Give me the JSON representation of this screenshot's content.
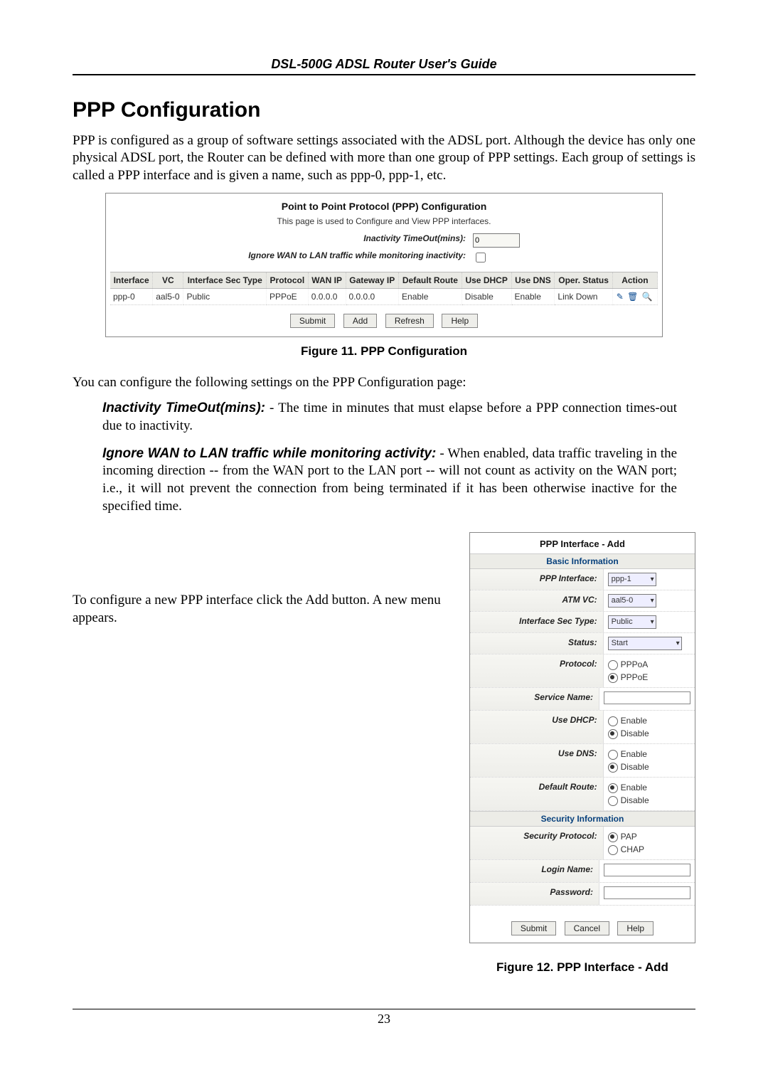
{
  "doc": {
    "running_head": "DSL-500G ADSL Router User's Guide",
    "page_number": "23"
  },
  "section": {
    "title": "PPP Configuration",
    "intro": "PPP is configured as a group of software settings associated with the ADSL port. Although the device has only one physical ADSL port, the Router can be defined with more than one group of PPP settings. Each group of settings is called a PPP interface and is given a name, such as ppp-0, ppp-1, etc."
  },
  "fig11": {
    "title": "Point to Point Protocol (PPP) Configuration",
    "subtitle": "This page is used to Configure and View PPP interfaces.",
    "inactivity_label": "Inactivity TimeOut(mins):",
    "inactivity_value": "0",
    "ignore_label": "Ignore WAN to LAN traffic while monitoring inactivity:",
    "headers": [
      "Interface",
      "VC",
      "Interface Sec Type",
      "Protocol",
      "WAN IP",
      "Gateway IP",
      "Default Route",
      "Use DHCP",
      "Use DNS",
      "Oper. Status",
      "Action"
    ],
    "row": {
      "interface": "ppp-0",
      "vc": "aal5-0",
      "sec_type": "Public",
      "protocol": "PPPoE",
      "wan_ip": "0.0.0.0",
      "gw_ip": "0.0.0.0",
      "default_route": "Enable",
      "use_dhcp": "Disable",
      "use_dns": "Enable",
      "oper_status": "Link Down"
    },
    "buttons": {
      "submit": "Submit",
      "add": "Add",
      "refresh": "Refresh",
      "help": "Help"
    },
    "caption": "Figure 11. PPP Configuration"
  },
  "after_fig11": {
    "lead": "You can configure the following settings on the PPP Configuration page:",
    "item1_lead": "Inactivity TimeOut(mins):",
    "item1_body": " - The time in minutes that must elapse before a PPP connection times-out due to inactivity.",
    "item2_lead": "Ignore WAN to LAN traffic while monitoring activity:",
    "item2_body": " - When enabled, data traffic traveling in the incoming direction -- from the WAN port to the LAN port -- will not count as activity on the WAN port; i.e., it will not prevent the connection from being terminated if it has been otherwise inactive for the specified time."
  },
  "add_intro": "To configure a new PPP interface click the Add button. A new menu appears.",
  "fig12": {
    "title": "PPP Interface - Add",
    "section_basic": "Basic Information",
    "section_security": "Security Information",
    "rows": {
      "ppp_interface": {
        "k": "PPP Interface:",
        "v": "ppp-1"
      },
      "atm_vc": {
        "k": "ATM VC:",
        "v": "aal5-0"
      },
      "sec_type": {
        "k": "Interface Sec Type:",
        "v": "Public"
      },
      "status": {
        "k": "Status:",
        "v": "Start"
      },
      "protocol": {
        "k": "Protocol:",
        "a": "PPPoA",
        "b": "PPPoE"
      },
      "service": {
        "k": "Service Name:"
      },
      "use_dhcp": {
        "k": "Use DHCP:",
        "a": "Enable",
        "b": "Disable"
      },
      "use_dns": {
        "k": "Use DNS:",
        "a": "Enable",
        "b": "Disable"
      },
      "default_route": {
        "k": "Default Route:",
        "a": "Enable",
        "b": "Disable"
      },
      "sec_proto": {
        "k": "Security Protocol:",
        "a": "PAP",
        "b": "CHAP"
      },
      "login": {
        "k": "Login Name:"
      },
      "password": {
        "k": "Password:"
      }
    },
    "buttons": {
      "submit": "Submit",
      "cancel": "Cancel",
      "help": "Help"
    },
    "caption": "Figure 12. PPP Interface - Add"
  }
}
